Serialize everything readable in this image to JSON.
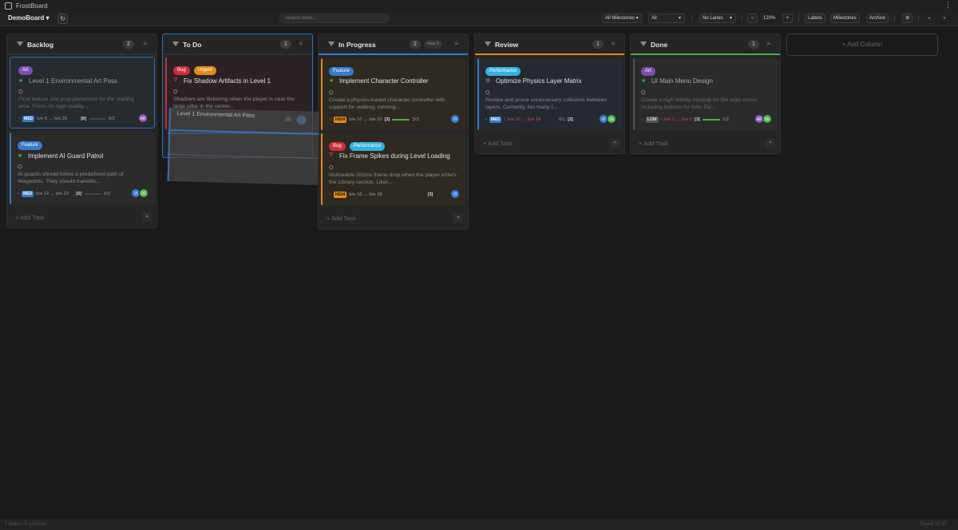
{
  "app": {
    "title": "FrostBoard"
  },
  "toolbar": {
    "board": "DemoBoard ▾",
    "refresh": "↻",
    "search_placeholder": "Search tasks...",
    "milestones_filter": "All Milestones ▾",
    "all_filter": "All",
    "lanes": "No Lanes",
    "zoom_out": "−",
    "zoom": "120%",
    "zoom_in": "+",
    "labels": "Labels",
    "milestones": "Milestones",
    "archive": "Archive",
    "settings": "⚙",
    "back": "◂",
    "forward": "▸"
  },
  "columns": [
    {
      "title": "Backlog",
      "count": "2",
      "accent": "#2e2e2e",
      "add_task": "+ Add Task",
      "cards": [
        {
          "labels": [
            {
              "text": "Art",
              "color": "#7b4fb0"
            }
          ],
          "type": "star",
          "title": "Level 1 Environmental Art Pass",
          "desc": "Final texture and prop placement for the starting area. Focus on high-quality...",
          "prio": "MED",
          "dates": "b/e 5 → b/e 25",
          "points": "[8]",
          "progress_text": "0/2",
          "progress": 0,
          "avatars": [
            {
              "t": "AR",
              "c": "#8a5bb8"
            }
          ]
        },
        {
          "labels": [
            {
              "text": "Feature",
              "color": "#3b79c9"
            }
          ],
          "type": "star",
          "title": "Implement AI Guard Patrol",
          "desc": "AI guards should follow a predefined path of Waypoints. They should transitio...",
          "prio": "MED",
          "dates": "b/e 12 → b/e 22",
          "points": "[5]",
          "progress_text": "0/2",
          "progress": 0,
          "avatars": [
            {
              "t": "VI",
              "c": "#3b79c9"
            },
            {
              "t": "DE",
              "c": "#4caf50"
            }
          ]
        }
      ]
    },
    {
      "title": "To Do",
      "count": "1",
      "accent": "#2e2e2e",
      "add_task": "+ Add Task",
      "cards": [
        {
          "labels": [
            {
              "text": "Bug",
              "color": "#c9303b"
            },
            {
              "text": "Urgent",
              "color": "#e08a1e"
            }
          ],
          "type": "bug",
          "title": "Fix Shadow Artifacts in Level 1",
          "desc": "Shadows are flickering when the player is near the large pillar in the center..."
        }
      ]
    },
    {
      "title": "In Progress",
      "count": "2",
      "wip": "max 5",
      "accent": "#3b79c9",
      "add_task": "+ Add Task",
      "cards": [
        {
          "labels": [
            {
              "text": "Feature",
              "color": "#3b79c9"
            }
          ],
          "type": "star",
          "title": "Implement Character Controller",
          "desc": "Create a physics-based character controller with support for walking, running...",
          "prio": "HIGH",
          "dates": "b/e 10 → b/e 20",
          "points": "[3]",
          "progress_text": "3/3",
          "progress": 1,
          "avatars": [
            {
              "t": "VI",
              "c": "#3b79c9"
            }
          ]
        },
        {
          "labels": [
            {
              "text": "Bug",
              "color": "#c9303b"
            },
            {
              "text": "Performance",
              "color": "#3ab0e0"
            }
          ],
          "type": "bug",
          "title": "Fix Frame Spikes during Level Loading",
          "desc": "Noticeable 200ms frame drop when the player enters the Library section. Likel...",
          "prio": "HIGH",
          "dates": "b/e 16 → b/e 18",
          "points": "[3]",
          "progress_text": "",
          "progress": -1,
          "avatars": [
            {
              "t": "VI",
              "c": "#3b79c9"
            }
          ]
        }
      ]
    },
    {
      "title": "Review",
      "count": "1",
      "accent": "#e08a1e",
      "add_task": "+ Add Task",
      "cards": [
        {
          "labels": [
            {
              "text": "Performance",
              "color": "#3ab0e0"
            }
          ],
          "type": "gear",
          "title": "Optimize Physics Layer Matrix",
          "desc": "Review and prune unnecessary collisions between layers. Currently, too many l...",
          "prio": "MED",
          "dates": "b/e 12 → b/e 14",
          "points": "[2]",
          "progress_text": "0/1",
          "progress": 0,
          "avatars": [
            {
              "t": "VI",
              "c": "#3b79c9"
            },
            {
              "t": "DE",
              "c": "#4caf50"
            }
          ]
        }
      ]
    },
    {
      "title": "Done",
      "count": "1",
      "accent": "#4caf50",
      "add_task": "+ Add Task",
      "cards": [
        {
          "labels": [
            {
              "text": "Art",
              "color": "#7b4fb0"
            }
          ],
          "type": "star",
          "title": "UI Main Menu Design",
          "desc": "Create a high-fidelity mockup for the main menu, including buttons for New Ga...",
          "prio": "LOW",
          "dates": "b/e 1 → b/e 5",
          "points": "[3]",
          "progress_text": "2/2",
          "progress": 1,
          "avatars": [
            {
              "t": "AR",
              "c": "#8a5bb8"
            },
            {
              "t": "DE",
              "c": "#4caf50"
            }
          ]
        }
      ]
    }
  ],
  "add_column": "+ Add Column",
  "drag_ghost": {
    "title": "Level 1 Environmental Art Pass",
    "points": "[8]"
  },
  "status": {
    "left": "7 tasks • 5 columns",
    "right": "Saved 10:37"
  },
  "colors": {
    "bg": "#1a1a1a",
    "column": "#252525",
    "card": "#2b2b2b",
    "accent_blue": "#3b79c9"
  }
}
